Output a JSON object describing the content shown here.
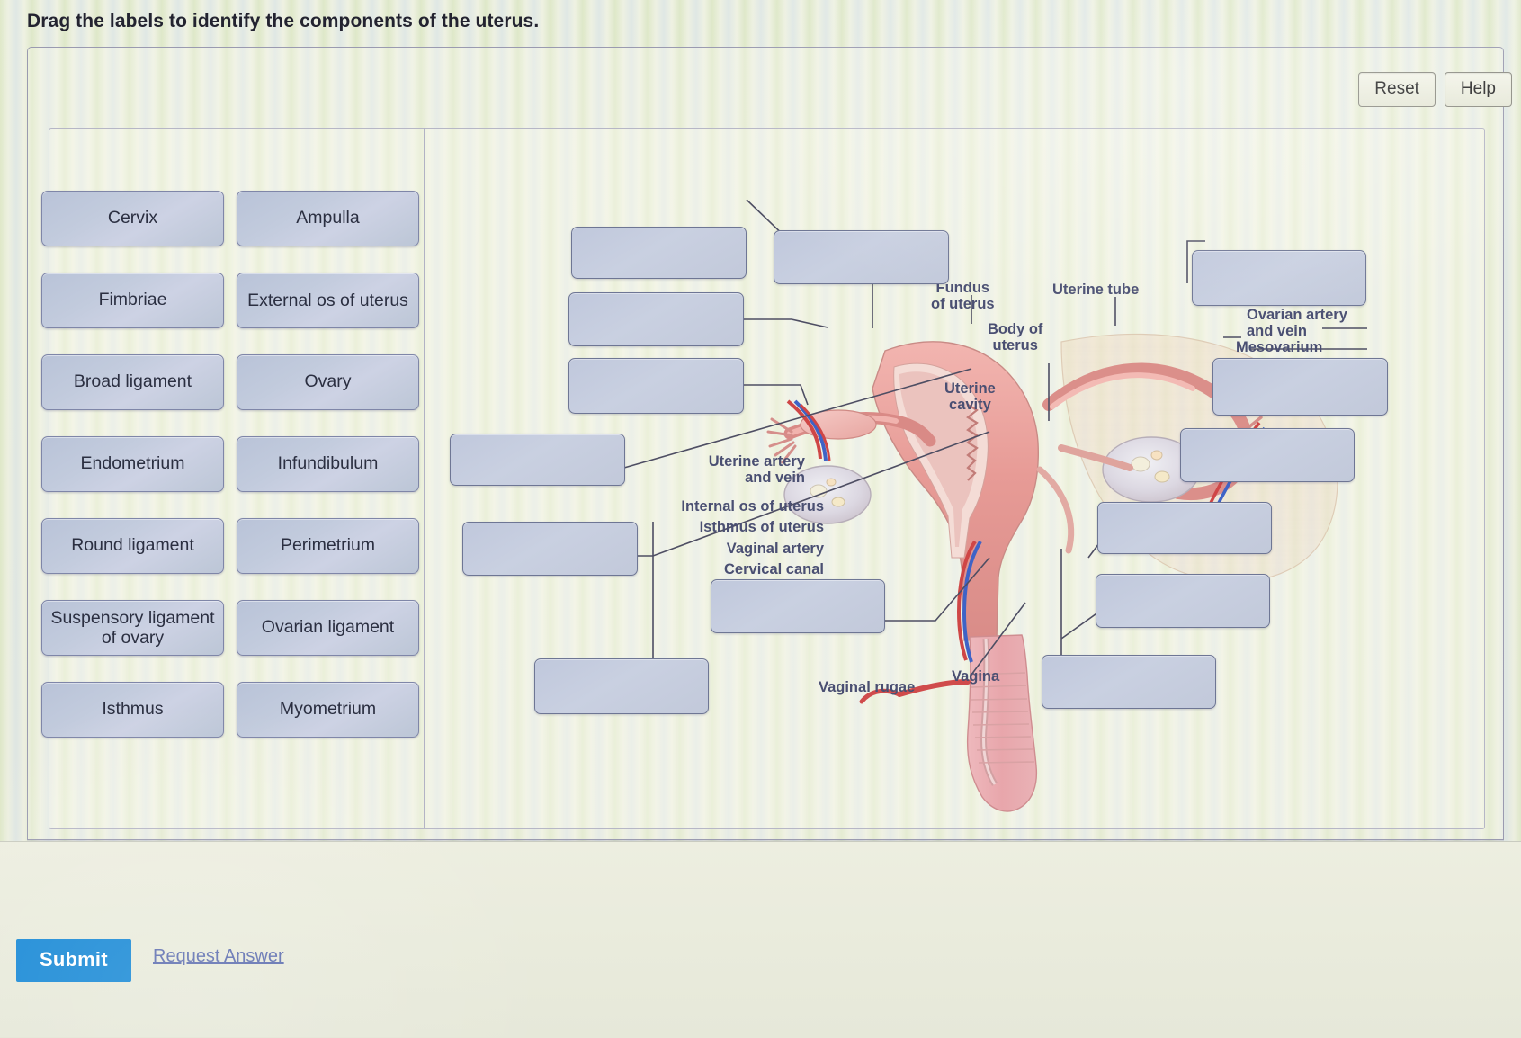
{
  "prompt": "Drag the labels to identify the components of the uterus.",
  "toolbar": {
    "reset_label": "Reset",
    "help_label": "Help"
  },
  "footer": {
    "submit_label": "Submit",
    "request_answer_label": "Request Answer"
  },
  "label_bank": {
    "rows": [
      [
        {
          "label": "Cervix"
        },
        {
          "label": "Ampulla"
        }
      ],
      [
        {
          "label": "Fimbriae"
        },
        {
          "label": "External os of uterus"
        }
      ],
      [
        {
          "label": "Broad ligament"
        },
        {
          "label": "Ovary"
        }
      ],
      [
        {
          "label": "Endometrium"
        },
        {
          "label": "Infundibulum"
        }
      ],
      [
        {
          "label": "Round ligament"
        },
        {
          "label": "Perimetrium"
        }
      ],
      [
        {
          "label": "Suspensory ligament of ovary"
        },
        {
          "label": "Ovarian ligament"
        }
      ],
      [
        {
          "label": "Isthmus"
        },
        {
          "label": "Myometrium"
        }
      ]
    ]
  },
  "diagram": {
    "static_labels": [
      {
        "text": "Fundus\nof uterus"
      },
      {
        "text": "Uterine tube"
      },
      {
        "text": "Ovarian artery\nand vein"
      },
      {
        "text": "Mesovarium"
      },
      {
        "text": "Body of\nuterus"
      },
      {
        "text": "Uterine\ncavity"
      },
      {
        "text": "Uterine artery\nand vein"
      },
      {
        "text": "Internal os of uterus"
      },
      {
        "text": "Isthmus of uterus"
      },
      {
        "text": "Vaginal artery"
      },
      {
        "text": "Cervical canal"
      },
      {
        "text": "Vaginal rugae"
      },
      {
        "text": "Vagina"
      }
    ],
    "dropzone_count": 14
  },
  "colors": {
    "submit_blue": "#1a8ad6",
    "chip_fill": "#c2cbdd",
    "chip_border": "#7f86a8",
    "label_text": "#4a4f72",
    "page_bg": "#eef0e0"
  }
}
